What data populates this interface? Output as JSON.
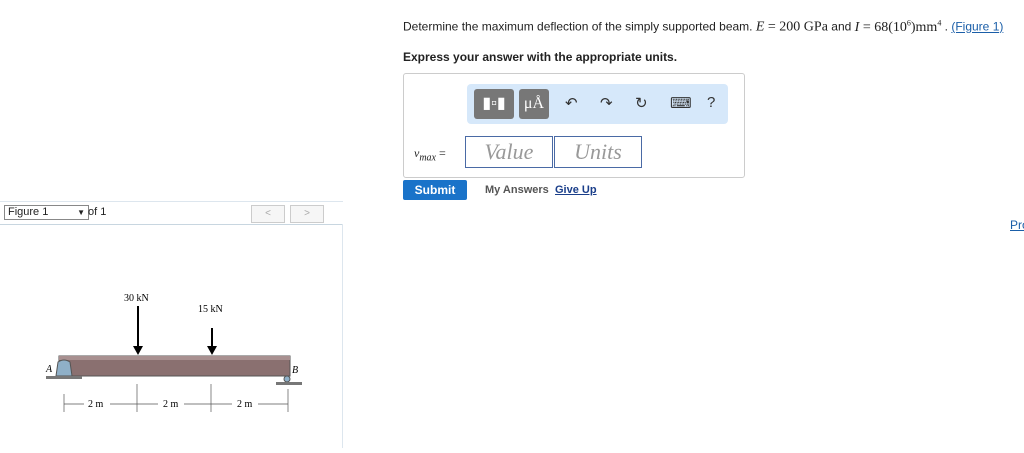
{
  "question": {
    "text": "Determine the maximum deflection of the simply supported beam.",
    "e_expr": "E = 200 GPa",
    "and": "and",
    "i_expr": "I = 68(10",
    "i_exp": "6",
    "i_unit": ")mm",
    "i_unit_exp": "4",
    "period": " . ",
    "figure_link": "(Figure 1)"
  },
  "express": "Express your answer with the appropriate units.",
  "toolbar": {
    "templates": "▯▫",
    "units": "μÅ",
    "undo": "↶",
    "redo": "↷",
    "reset": "↻",
    "keyboard": "⌨",
    "help": "?"
  },
  "answer": {
    "label": "v",
    "label_sub": "max",
    "equals": " =",
    "value_placeholder": "Value",
    "units_placeholder": "Units"
  },
  "actions": {
    "submit": "Submit",
    "my_answers": "My Answers",
    "give_up": "Give Up"
  },
  "right_link": "Pro",
  "figure": {
    "select": "Figure 1",
    "of": "of 1",
    "prev": "<",
    "next": ">",
    "load1": "30 kN",
    "load2": "15 kN",
    "label_a": "A",
    "label_b": "B",
    "dims": [
      "2 m",
      "2 m",
      "2 m"
    ]
  }
}
